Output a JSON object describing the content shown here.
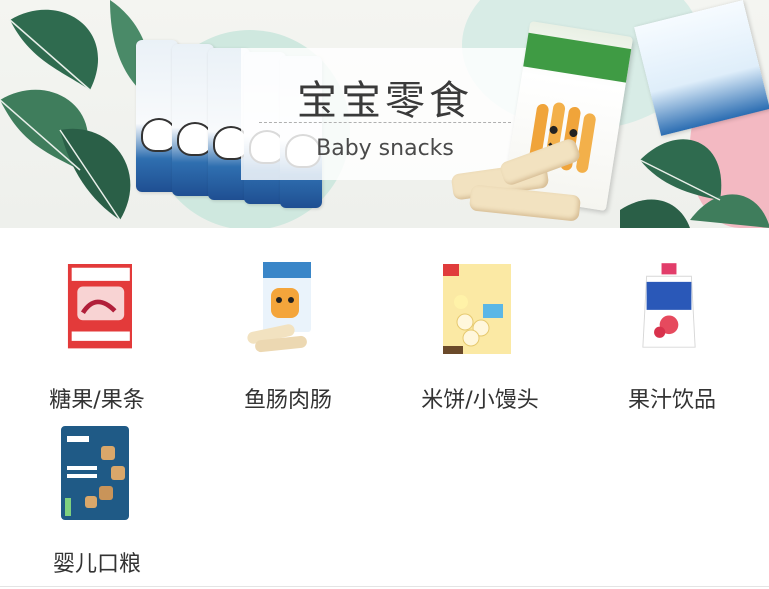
{
  "banner": {
    "title_cn": "宝宝零食",
    "title_en": "Baby snacks"
  },
  "categories": [
    {
      "label": "糖果/果条",
      "icon": "fruit-wriggles-box-icon"
    },
    {
      "label": "鱼肠肉肠",
      "icon": "fish-sausage-pack-icon"
    },
    {
      "label": "米饼/小馒头",
      "icon": "rice-puff-box-icon"
    },
    {
      "label": "果汁饮品",
      "icon": "juice-pouch-icon"
    },
    {
      "label": "婴儿口粮",
      "icon": "animal-crackers-bag-icon"
    }
  ],
  "colors": {
    "leaf_green": "#2f6b4f",
    "mint": "#cfe8df",
    "label_text": "#333333"
  }
}
